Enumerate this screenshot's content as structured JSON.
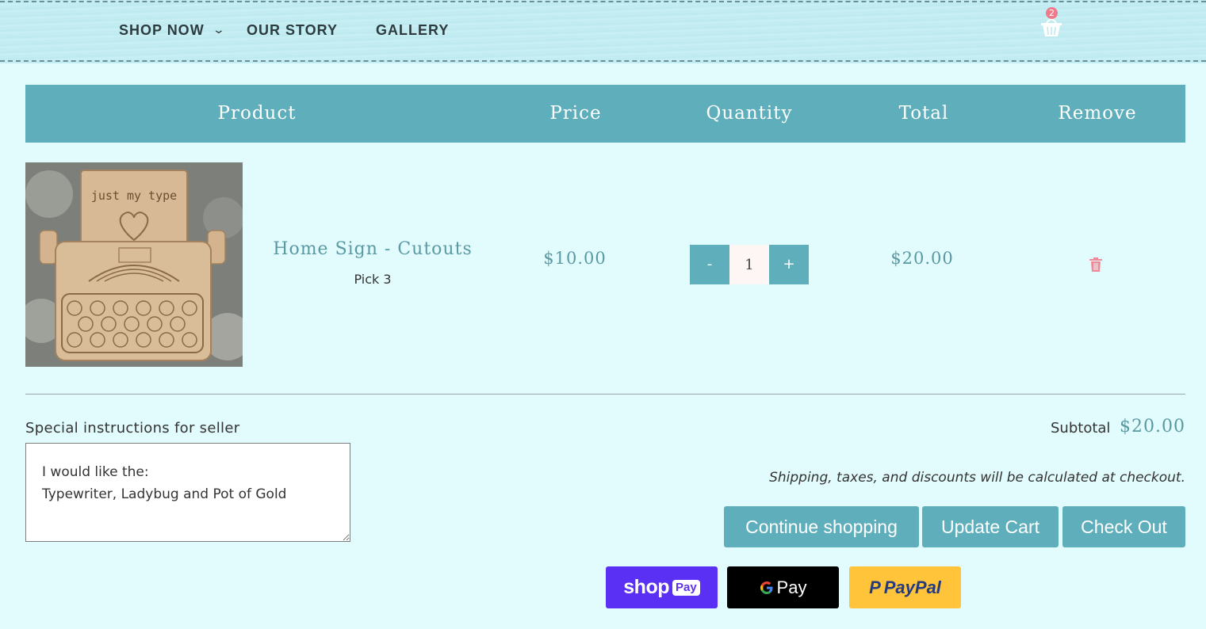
{
  "nav": {
    "shop_now": "SHOP NOW",
    "our_story": "OUR STORY",
    "gallery": "GALLERY"
  },
  "cart": {
    "count": "2"
  },
  "table": {
    "headers": [
      "Product",
      "Price",
      "Quantity",
      "Total",
      "Remove"
    ]
  },
  "item": {
    "name": "Home Sign - Cutouts",
    "variant": "Pick 3",
    "price": "$10.00",
    "quantity": "1",
    "total": "$20.00",
    "image_text": "just my type",
    "minus": "-",
    "plus": "+"
  },
  "notes": {
    "label": "Special instructions for seller",
    "value": "I would like the:\nTypewriter, Ladybug and Pot of Gold"
  },
  "summary": {
    "subtotal_label": "Subtotal",
    "subtotal_value": "$20.00",
    "shipping_note": "Shipping, taxes, and discounts will be calculated at checkout."
  },
  "buttons": {
    "continue": "Continue shopping",
    "update": "Update Cart",
    "checkout": "Check Out"
  },
  "payments": {
    "shop": "shop",
    "shop_pay": "Pay",
    "gpay": "Pay",
    "paypal": "PayPal"
  },
  "colors": {
    "accent": "#5eafbb",
    "background": "#e2fbfd",
    "shop_pay": "#5a31f4",
    "paypal": "#ffc439",
    "trash": "#f08a96"
  }
}
